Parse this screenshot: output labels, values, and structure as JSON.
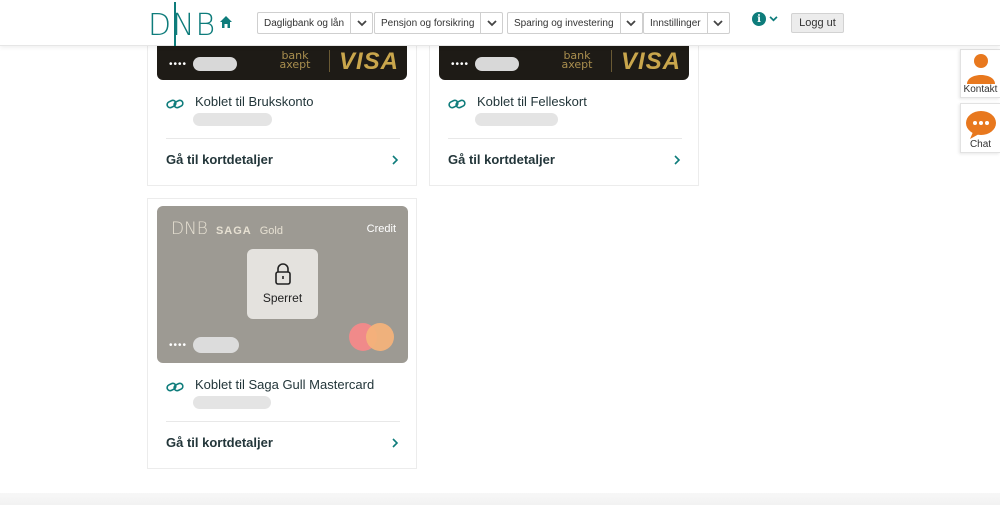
{
  "header": {
    "logo": "DNB",
    "nav": [
      {
        "label": "Dagligbank og lån"
      },
      {
        "label": "Pensjon og forsikring"
      },
      {
        "label": "Sparing og investering"
      },
      {
        "label": "Innstillinger"
      }
    ],
    "info_symbol": "i",
    "logout_label": "Logg ut"
  },
  "cards": [
    {
      "type": "VISA BankAxept",
      "masked_prefix": "••••",
      "bankaxept": "bank axept",
      "brand": "VISA",
      "linked_text": "Koblet til Brukskonto",
      "details_link": "Gå til kortdetaljer"
    },
    {
      "type": "VISA BankAxept",
      "masked_prefix": "••••",
      "bankaxept": "bank axept",
      "brand": "VISA",
      "linked_text": "Koblet til Felleskort",
      "details_link": "Gå til kortdetaljer"
    },
    {
      "type": "SAGA Gold Mastercard",
      "logo": "DNB",
      "product": "SAGA",
      "tier": "Gold",
      "kind": "Credit",
      "status": "Sperret",
      "masked_prefix": "••••",
      "linked_text": "Koblet til Saga Gull Mastercard",
      "details_link": "Gå til kortdetaljer"
    }
  ],
  "side": {
    "contact_label": "Kontakt",
    "chat_label": "Chat"
  },
  "colors": {
    "brand": "#0e7c7b",
    "visa_card": "#1e1b16",
    "saga_card": "#9d9a93",
    "contact_accent": "#e8781e"
  }
}
